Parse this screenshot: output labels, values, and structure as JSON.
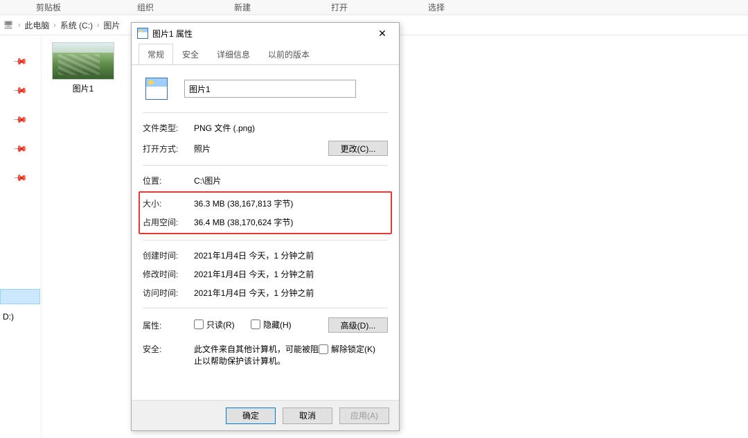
{
  "toolbar": {
    "clipboard": "剪贴板",
    "organize": "组织",
    "new": "新建",
    "open": "打开",
    "select": "选择"
  },
  "breadcrumb": {
    "pc": "此电脑",
    "drive": "系统 (C:)",
    "folder": "图片"
  },
  "sidebar": {
    "selected": "D:)"
  },
  "file": {
    "name": "图片1"
  },
  "dialog": {
    "title": "图片1 属性",
    "tabs": {
      "general": "常规",
      "security": "安全",
      "details": "详细信息",
      "previous": "以前的版本"
    },
    "filename": "图片1",
    "labels": {
      "type": "文件类型:",
      "opens_with": "打开方式:",
      "change": "更改(C)...",
      "location": "位置:",
      "size": "大小:",
      "size_on_disk": "占用空间:",
      "created": "创建时间:",
      "modified": "修改时间:",
      "accessed": "访问时间:",
      "attributes": "属性:",
      "readonly": "只读(R)",
      "hidden": "隐藏(H)",
      "advanced": "高级(D)...",
      "security": "安全:",
      "security_text": "此文件来自其他计算机，可能被阻止以帮助保护该计算机。",
      "unblock": "解除锁定(K)"
    },
    "values": {
      "type": "PNG 文件 (.png)",
      "opens_with": "照片",
      "location": "C:\\图片",
      "size": "36.3 MB (38,167,813 字节)",
      "size_on_disk": "36.4 MB (38,170,624 字节)",
      "created": "2021年1月4日 今天，1 分钟之前",
      "modified": "2021年1月4日 今天，1 分钟之前",
      "accessed": "2021年1月4日 今天，1 分钟之前"
    },
    "buttons": {
      "ok": "确定",
      "cancel": "取消",
      "apply": "应用(A)"
    }
  }
}
